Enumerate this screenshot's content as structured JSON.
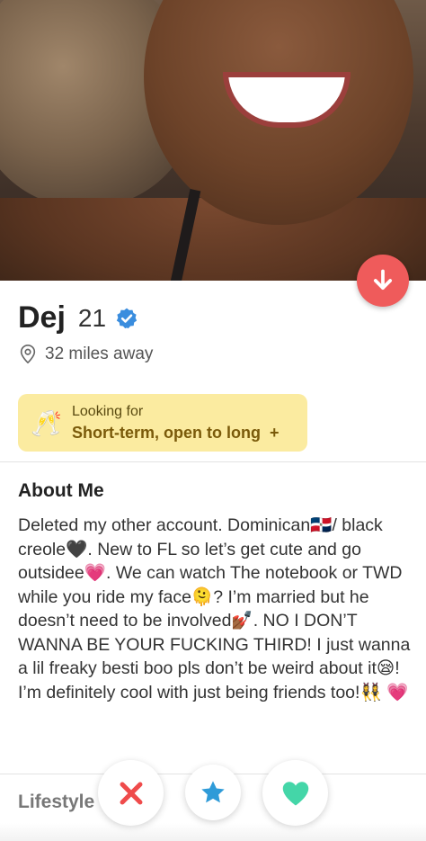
{
  "profile": {
    "name": "Dej",
    "age": "21",
    "distance": "32 miles away"
  },
  "looking_for": {
    "label": "Looking for",
    "value": "Short-term, open to long",
    "plus": "+",
    "emoji": "🥂"
  },
  "about": {
    "heading": "About Me",
    "text": "Deleted my other account. Dominican🇩🇴/ black creole🖤. New to FL so let’s get cute and go outsidee💗. We can watch The notebook or TWD while you ride my face🫠? I’m married but he doesn’t need to be involved💅🏾. NO I DON’T WANNA BE YOUR FUCKING THIRD! I just wanna a lil freaky besti boo pls don’t be weird about it😪! I’m definitely cool with just being friends too!👯‍♀️ 💗"
  },
  "lifestyle": {
    "heading": "Lifestyle"
  },
  "colors": {
    "accent_red": "#ef5b5b",
    "verified_blue": "#3a8dde",
    "looking_bg": "#fbeba0",
    "heart_green": "#44d6a8",
    "star_blue": "#2f9bd8",
    "x_red": "#ef4b4b"
  },
  "icons": {
    "collapse": "arrow-down-icon",
    "verified": "verified-badge-icon",
    "location": "location-pin-icon",
    "nope": "close-icon",
    "super_like": "star-icon",
    "like": "heart-icon"
  }
}
